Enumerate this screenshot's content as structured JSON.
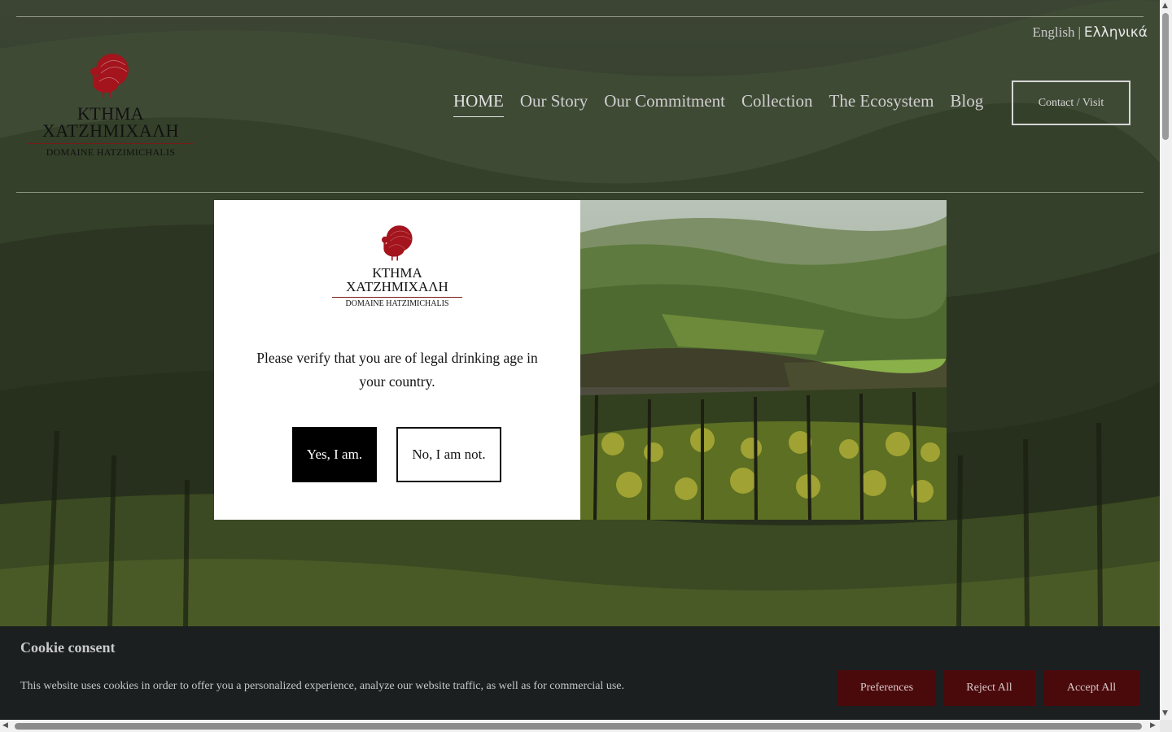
{
  "brand": {
    "greek_line1": "ΚΤΗΜΑ",
    "greek_line2": "ΧΑΤΖΗΜΙΧΑΛΗ",
    "latin_line": "DOMAINE HATZIMICHALIS",
    "turkey_color": "#a3141c"
  },
  "language": {
    "english": "English",
    "separator": "|",
    "greek": "Ελληνικά"
  },
  "nav": {
    "items": [
      {
        "label": "HOME",
        "active": true
      },
      {
        "label": "Our Story"
      },
      {
        "label": "Our Commitment"
      },
      {
        "label": "Collection"
      },
      {
        "label": "The Ecosystem"
      },
      {
        "label": "Blog"
      }
    ],
    "contact_label": "Contact / Visit"
  },
  "age_modal": {
    "message": "Please verify that you are of legal drinking age in your country.",
    "yes_label": "Yes, I am.",
    "no_label": "No, I am not."
  },
  "cookie": {
    "title": "Cookie consent",
    "text": "This website uses cookies in order to offer you a personalized experience, analyze our website traffic, as well as for commercial use.",
    "preferences_label": "Preferences",
    "reject_label": "Reject All",
    "accept_label": "Accept All",
    "button_color": "#4a0a0c"
  },
  "icons": {
    "scroll_up": "▲",
    "scroll_down": "▼",
    "scroll_left": "◀",
    "scroll_right": "▶"
  }
}
